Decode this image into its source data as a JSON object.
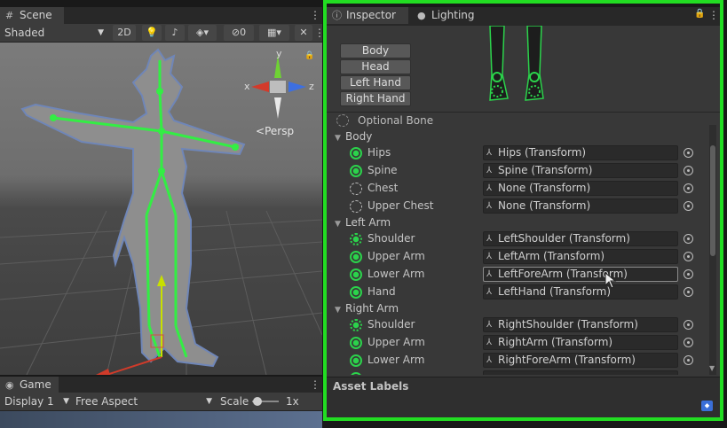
{
  "scene": {
    "tab_label": "Scene",
    "shading_mode": "Shaded",
    "btn_2d": "2D",
    "hidden_count": "0",
    "persp_label": "Persp",
    "gizmo_axes": {
      "x": "x",
      "y": "y",
      "z": "z"
    }
  },
  "game": {
    "tab_label": "Game",
    "display": "Display 1",
    "aspect": "Free Aspect",
    "scale_label": "Scale",
    "scale_value": "1x"
  },
  "inspector": {
    "tabs": [
      {
        "label": "Inspector",
        "icon": "info-icon"
      },
      {
        "label": "Lighting",
        "icon": "light-bulb-icon"
      }
    ],
    "mode_buttons": [
      "Body",
      "Head",
      "Left Hand",
      "Right Hand"
    ],
    "optional_bone": "Optional Bone",
    "sections": [
      {
        "title": "Body",
        "bones": [
          {
            "name": "Hips",
            "value": "Hips (Transform)",
            "state": "filled"
          },
          {
            "name": "Spine",
            "value": "Spine (Transform)",
            "state": "filled"
          },
          {
            "name": "Chest",
            "value": "None (Transform)",
            "state": "dotted"
          },
          {
            "name": "Upper Chest",
            "value": "None (Transform)",
            "state": "dotted"
          }
        ]
      },
      {
        "title": "Left Arm",
        "bones": [
          {
            "name": "Shoulder",
            "value": "LeftShoulder (Transform)",
            "state": "filled-dotted"
          },
          {
            "name": "Upper Arm",
            "value": "LeftArm (Transform)",
            "state": "filled"
          },
          {
            "name": "Lower Arm",
            "value": "LeftForeArm (Transform)",
            "state": "filled"
          },
          {
            "name": "Hand",
            "value": "LeftHand (Transform)",
            "state": "filled"
          }
        ]
      },
      {
        "title": "Right Arm",
        "bones": [
          {
            "name": "Shoulder",
            "value": "RightShoulder (Transform)",
            "state": "filled-dotted"
          },
          {
            "name": "Upper Arm",
            "value": "RightArm (Transform)",
            "state": "filled"
          },
          {
            "name": "Lower Arm",
            "value": "RightForeArm (Transform)",
            "state": "filled"
          }
        ]
      }
    ],
    "asset_labels": "Asset Labels"
  },
  "colors": {
    "highlight_frame": "#22dd22",
    "bone_green": "#2bd34b",
    "panel_bg": "#383838"
  }
}
